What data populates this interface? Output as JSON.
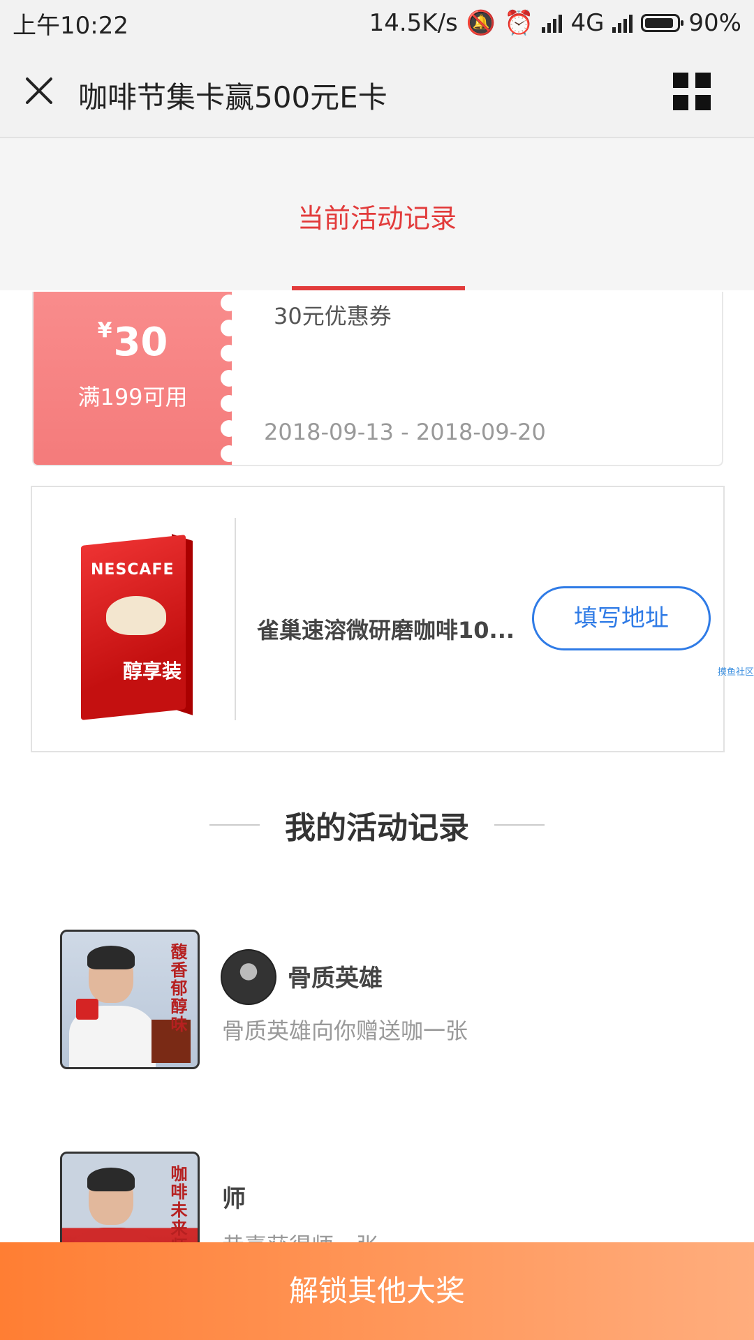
{
  "status_bar": {
    "time": "上午10:22",
    "net_speed": "14.5K/s",
    "network": "4G",
    "battery": "90%"
  },
  "header": {
    "title": "咖啡节集卡赢500元E卡"
  },
  "tabs": {
    "active_label": "当前活动记录"
  },
  "coupon": {
    "currency": "¥",
    "amount": "30",
    "condition": "满199可用",
    "title": "30元优惠券",
    "date_range": "2018-09-13 - 2018-09-20"
  },
  "product": {
    "name": "雀巢速溶微研磨咖啡10...",
    "button_label": "填写地址",
    "box_brand": "NESCAFE",
    "box_label": "醇享装"
  },
  "watermark": "摸鱼社区",
  "records": {
    "section_title": "我的活动记录",
    "items": [
      {
        "card_text": "馥香郁醇味",
        "name": "骨质英雄",
        "desc": "骨质英雄向你赠送咖一张"
      },
      {
        "card_text": "咖啡未来师",
        "name": "师",
        "desc": "恭喜获得师一张"
      }
    ]
  },
  "bottom": {
    "button_label": "解锁其他大奖"
  },
  "colors": {
    "accent_red": "#e23b3b",
    "coupon_pink": "#f98c8c",
    "link_blue": "#2f7be6",
    "bottom_orange": "#ff7e33"
  }
}
